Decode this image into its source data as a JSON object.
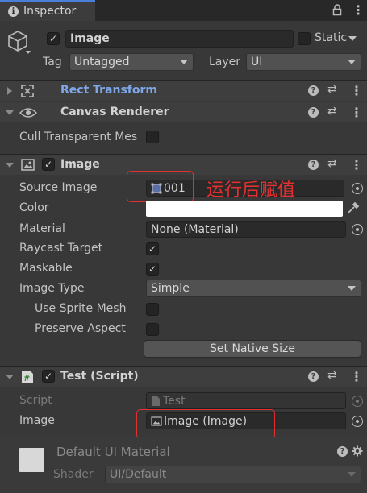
{
  "window": {
    "tab_label": "Inspector"
  },
  "object": {
    "name": "Image",
    "static_label": "Static",
    "tag_label": "Tag",
    "tag_value": "Untagged",
    "layer_label": "Layer",
    "layer_value": "UI"
  },
  "rect_transform": {
    "title": "Rect Transform"
  },
  "canvas_renderer": {
    "title": "Canvas Renderer",
    "cull_label": "Cull Transparent Mes"
  },
  "image_component": {
    "title": "Image",
    "source_image_label": "Source Image",
    "source_image_value": "001",
    "color_label": "Color",
    "material_label": "Material",
    "material_value": "None (Material)",
    "raycast_label": "Raycast Target",
    "maskable_label": "Maskable",
    "image_type_label": "Image Type",
    "image_type_value": "Simple",
    "use_sprite_mesh_label": "Use Sprite Mesh",
    "preserve_aspect_label": "Preserve Aspect",
    "set_native_size_label": "Set Native Size",
    "annotation": "运行后赋值"
  },
  "test_script": {
    "title": "Test (Script)",
    "script_label": "Script",
    "script_value": "Test",
    "image_label": "Image",
    "image_value": "Image (Image)"
  },
  "material_footer": {
    "title": "Default UI Material",
    "shader_label": "Shader",
    "shader_value": "UI/Default"
  },
  "colors": {
    "background": "#383838",
    "header": "#3e3e3e",
    "accent_link": "#7ea6e8",
    "annotation_red": "#e03030"
  }
}
